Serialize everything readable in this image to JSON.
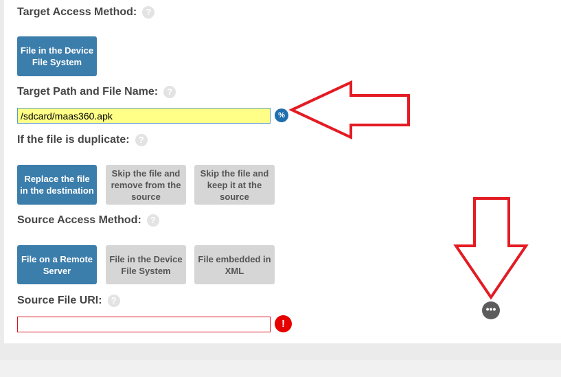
{
  "target_access": {
    "label": "Target Access Method:",
    "buttons": [
      "File in the Device File System"
    ]
  },
  "target_path": {
    "label": "Target Path and File Name:",
    "value": "/sdcard/maas360.apk"
  },
  "duplicate": {
    "label": "If the file is duplicate:",
    "buttons": [
      "Replace the file in the destination",
      "Skip the file and remove from the source",
      "Skip the file and keep it at the source"
    ]
  },
  "source_access": {
    "label": "Source Access Method:",
    "buttons": [
      "File on a Remote Server",
      "File in the Device File System",
      "File embedded in XML"
    ]
  },
  "source_uri": {
    "label": "Source File URI:",
    "value": ""
  },
  "icons": {
    "help": "?",
    "variable": "%",
    "error": "!",
    "more": "•••"
  },
  "colors": {
    "active": "#3b7dab",
    "inactive": "#d6d6d6",
    "highlight_input": "#ffff88",
    "annotation_arrow": "#e31b23",
    "error": "#e60000"
  }
}
